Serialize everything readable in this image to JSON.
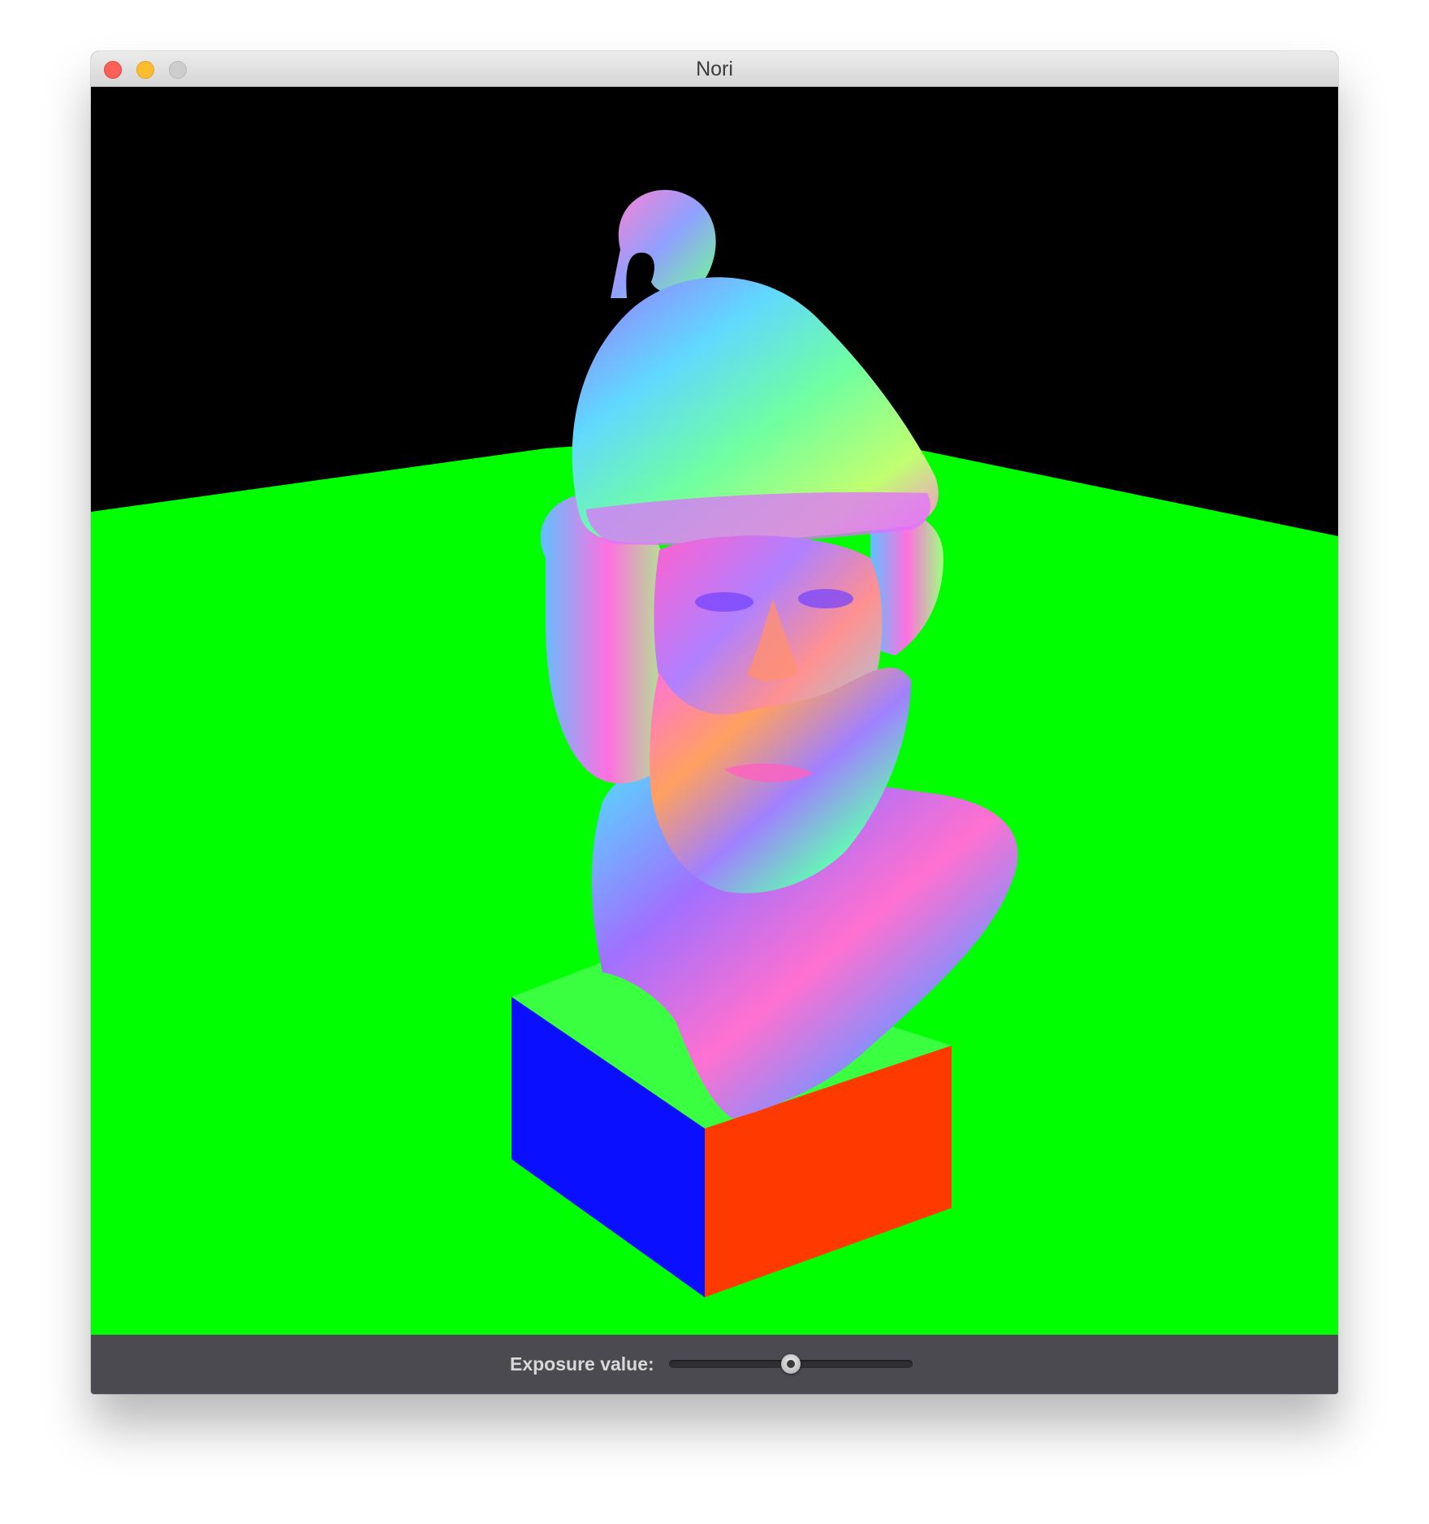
{
  "window": {
    "title": "Nori",
    "buttons": {
      "close_color": "#fe5f57",
      "minimize_color": "#febc2e",
      "zoom_color": "#cdcdcd"
    }
  },
  "render": {
    "background_color": "#000000",
    "ground_color": "#00ff00"
  },
  "controls": {
    "exposure_label": "Exposure value:",
    "exposure_slider_fraction": 0.5
  }
}
